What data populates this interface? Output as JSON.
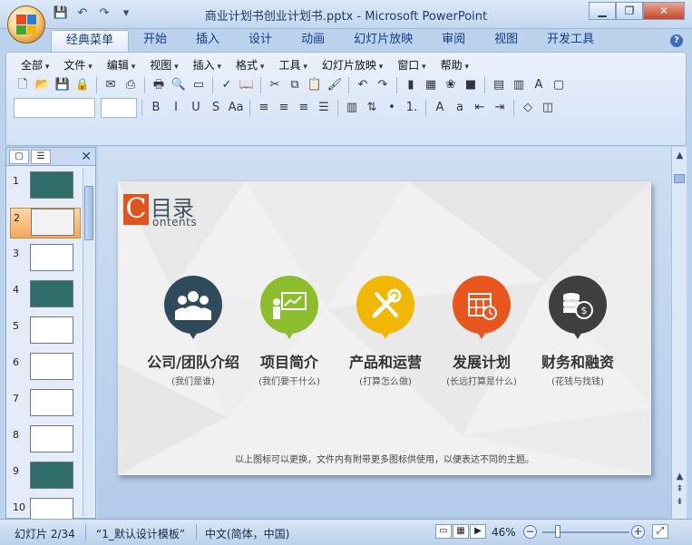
{
  "window": {
    "title": "商业计划书创业计划书.pptx - Microsoft PowerPoint",
    "min_label": "▁",
    "max_label": "❐",
    "close_label": "✕"
  },
  "quick_access": [
    "save-icon",
    "undo-icon",
    "redo-icon",
    "customize-icon"
  ],
  "ribbon_tabs": [
    {
      "label": "经典菜单",
      "active": true
    },
    {
      "label": "开始"
    },
    {
      "label": "插入"
    },
    {
      "label": "设计"
    },
    {
      "label": "动画"
    },
    {
      "label": "幻灯片放映"
    },
    {
      "label": "审阅"
    },
    {
      "label": "视图"
    },
    {
      "label": "开发工具"
    }
  ],
  "menu": [
    "全部",
    "文件",
    "编辑",
    "视图",
    "插入",
    "格式",
    "工具",
    "幻灯片放映",
    "窗口",
    "帮助"
  ],
  "toolbar_row1": [
    "new-icon",
    "open-icon",
    "save-icon",
    "permission-icon",
    "|",
    "email-icon",
    "publish-icon",
    "|",
    "print-icon",
    "print-preview-icon",
    "page-setup-icon",
    "|",
    "spelling-icon",
    "research-icon",
    "|",
    "cut-icon",
    "copy-icon",
    "paste-icon",
    "format-painter-icon",
    "|",
    "undo-icon",
    "redo-icon",
    "|",
    "chart-icon",
    "table-icon",
    "clipart-icon",
    "color-icon",
    "|",
    "new-slide-icon",
    "layout-icon",
    "font-color-icon",
    "folder-icon"
  ],
  "toolbar_row2": [
    "bold-icon",
    "italic-icon",
    "underline-icon",
    "strikethrough-icon",
    "change-case-icon",
    "|",
    "align-left-icon",
    "align-center-icon",
    "align-right-icon",
    "justify-icon",
    "|",
    "columns-icon",
    "text-direction-icon",
    "bullets-icon",
    "numbering-icon",
    "|",
    "font-grow-icon",
    "font-shrink-icon",
    "decrease-indent-icon",
    "increase-indent-icon",
    "|",
    "shapes-icon",
    "arrange-icon"
  ],
  "toolbar_glyphs": {
    "new-icon": "🗋",
    "open-icon": "📂",
    "save-icon": "💾",
    "permission-icon": "🔒",
    "email-icon": "✉",
    "publish-icon": "⎙",
    "print-icon": "🖶",
    "print-preview-icon": "🔍",
    "page-setup-icon": "▭",
    "spelling-icon": "✓",
    "research-icon": "📖",
    "cut-icon": "✂",
    "copy-icon": "⧉",
    "paste-icon": "📋",
    "format-painter-icon": "🖌",
    "undo-icon": "↶",
    "redo-icon": "↷",
    "chart-icon": "▮",
    "table-icon": "▦",
    "clipart-icon": "❀",
    "color-icon": "■",
    "new-slide-icon": "▤",
    "layout-icon": "▥",
    "font-color-icon": "A",
    "folder-icon": "▢",
    "bold-icon": "B",
    "italic-icon": "I",
    "underline-icon": "U",
    "strikethrough-icon": "S",
    "change-case-icon": "Aa",
    "align-left-icon": "≡",
    "align-center-icon": "≡",
    "align-right-icon": "≡",
    "justify-icon": "☰",
    "columns-icon": "▥",
    "text-direction-icon": "⇅",
    "bullets-icon": "•",
    "numbering-icon": "1.",
    "font-grow-icon": "A",
    "font-shrink-icon": "a",
    "decrease-indent-icon": "⇤",
    "increase-indent-icon": "⇥",
    "shapes-icon": "◇",
    "arrange-icon": "◫",
    "customize-icon": "▾"
  },
  "thumbnails": [
    {
      "num": "1",
      "selected": false,
      "color": "#2f6e6a"
    },
    {
      "num": "2",
      "selected": true,
      "color": "#f2f2f2"
    },
    {
      "num": "3",
      "selected": false,
      "color": "#ffffff"
    },
    {
      "num": "4",
      "selected": false,
      "color": "#2f6e6a"
    },
    {
      "num": "5",
      "selected": false,
      "color": "#ffffff"
    },
    {
      "num": "6",
      "selected": false,
      "color": "#ffffff"
    },
    {
      "num": "7",
      "selected": false,
      "color": "#ffffff"
    },
    {
      "num": "8",
      "selected": false,
      "color": "#ffffff"
    },
    {
      "num": "9",
      "selected": false,
      "color": "#2f6e6a"
    },
    {
      "num": "10",
      "selected": false,
      "color": "#ffffff"
    }
  ],
  "slide": {
    "c_letter": "C",
    "title": "目录",
    "subtitle": "ontents",
    "items": [
      {
        "label": "公司/团队介绍",
        "sub": "(我们是谁)",
        "color": "#2f4a5a",
        "icon": "team-icon"
      },
      {
        "label": "项目简介",
        "sub": "(我们要干什么)",
        "color": "#8bbd2d",
        "icon": "presentation-icon"
      },
      {
        "label": "产品和运营",
        "sub": "(打算怎么做)",
        "color": "#f2b705",
        "icon": "tools-icon"
      },
      {
        "label": "发展计划",
        "sub": "(长远打算是什么)",
        "color": "#e8561e",
        "icon": "calendar-icon"
      },
      {
        "label": "财务和融资",
        "sub": "(花钱与找钱)",
        "color": "#3f3f3f",
        "icon": "coins-icon"
      }
    ],
    "footnote": "以上图标可以更换，文件内有附带更多图标供使用，以便表达不同的主题。"
  },
  "status": {
    "slide_info": "幻灯片 2/34",
    "theme": "“1_默认设计模板”",
    "language": "中文(简体，中国)",
    "zoom": "46%"
  }
}
